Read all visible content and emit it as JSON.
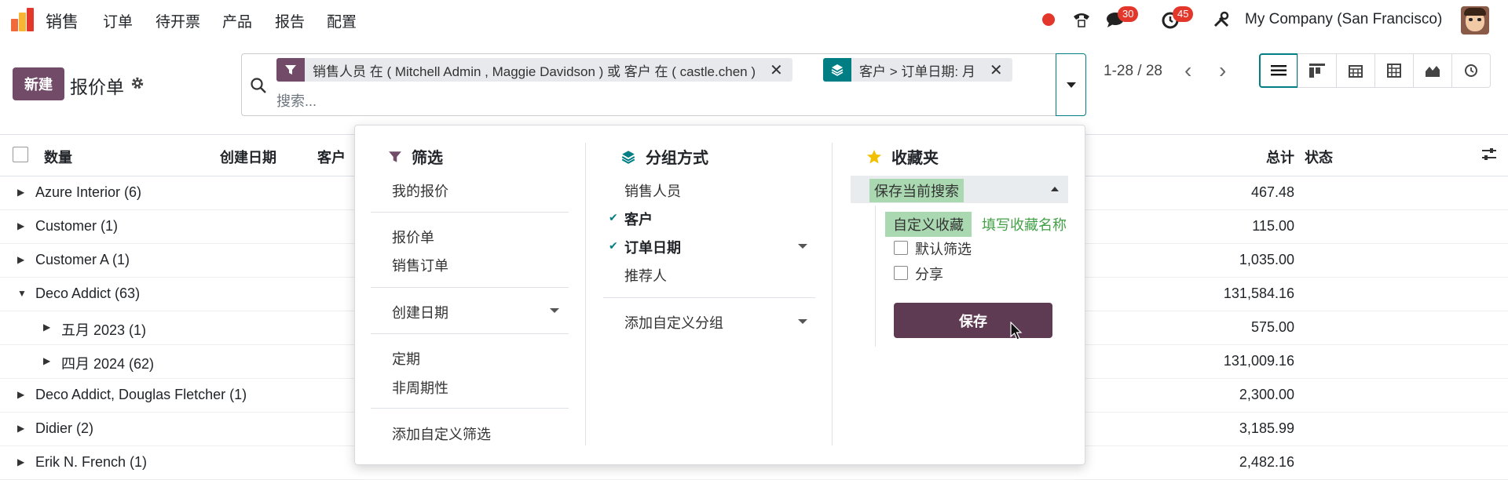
{
  "topnav": {
    "app_name": "销售",
    "menu": [
      "订单",
      "待开票",
      "产品",
      "报告",
      "配置"
    ],
    "messages_count": "30",
    "activities_count": "45",
    "company": "My Company (San Francisco)"
  },
  "control": {
    "new_label": "新建",
    "title": "报价单",
    "facets": [
      {
        "text": "销售人员 在 ( Mitchell Admin , Maggie Davidson ) 或 客户 在 ( castle.chen )",
        "icon": "filter-icon",
        "color": "#714b67"
      },
      {
        "text": "客户 > 订单日期: 月",
        "icon": "layers-icon",
        "color": "#017e84"
      }
    ],
    "search_placeholder": "搜索...",
    "pager": "1-28 / 28"
  },
  "list": {
    "headers": {
      "count": "数量",
      "created": "创建日期",
      "customer": "客户",
      "total": "总计",
      "status": "状态"
    },
    "rows": [
      {
        "label": "Azure Interior (6)",
        "total": "467.48",
        "level": 0,
        "open": false
      },
      {
        "label": "Customer (1)",
        "total": "115.00",
        "level": 0,
        "open": false
      },
      {
        "label": "Customer A (1)",
        "total": "1,035.00",
        "level": 0,
        "open": false
      },
      {
        "label": "Deco Addict (63)",
        "total": "131,584.16",
        "level": 0,
        "open": true
      },
      {
        "label": "五月 2023 (1)",
        "total": "575.00",
        "level": 1,
        "open": false
      },
      {
        "label": "四月 2024 (62)",
        "total": "131,009.16",
        "level": 1,
        "open": false
      },
      {
        "label": "Deco Addict, Douglas Fletcher (1)",
        "total": "2,300.00",
        "level": 0,
        "open": false
      },
      {
        "label": "Didier (2)",
        "total": "3,185.99",
        "level": 0,
        "open": false
      },
      {
        "label": "Erik N. French (1)",
        "total": "2,482.16",
        "level": 0,
        "open": false
      }
    ]
  },
  "dropdown": {
    "filters": {
      "title": "筛选",
      "my_quotes": "我的报价",
      "quotes": "报价单",
      "sales_orders": "销售订单",
      "created_date": "创建日期",
      "recurring": "定期",
      "non_recurring": "非周期性",
      "add_custom": "添加自定义筛选"
    },
    "groupby": {
      "title": "分组方式",
      "salesperson": "销售人员",
      "customer": "客户",
      "order_date": "订单日期",
      "referrer": "推荐人",
      "add_custom": "添加自定义分组"
    },
    "favorites": {
      "title": "收藏夹",
      "save_current": "保存当前搜索",
      "custom_name": "自定义收藏",
      "hint": "填写收藏名称",
      "default_filter": "默认筛选",
      "share": "分享",
      "save": "保存"
    }
  }
}
